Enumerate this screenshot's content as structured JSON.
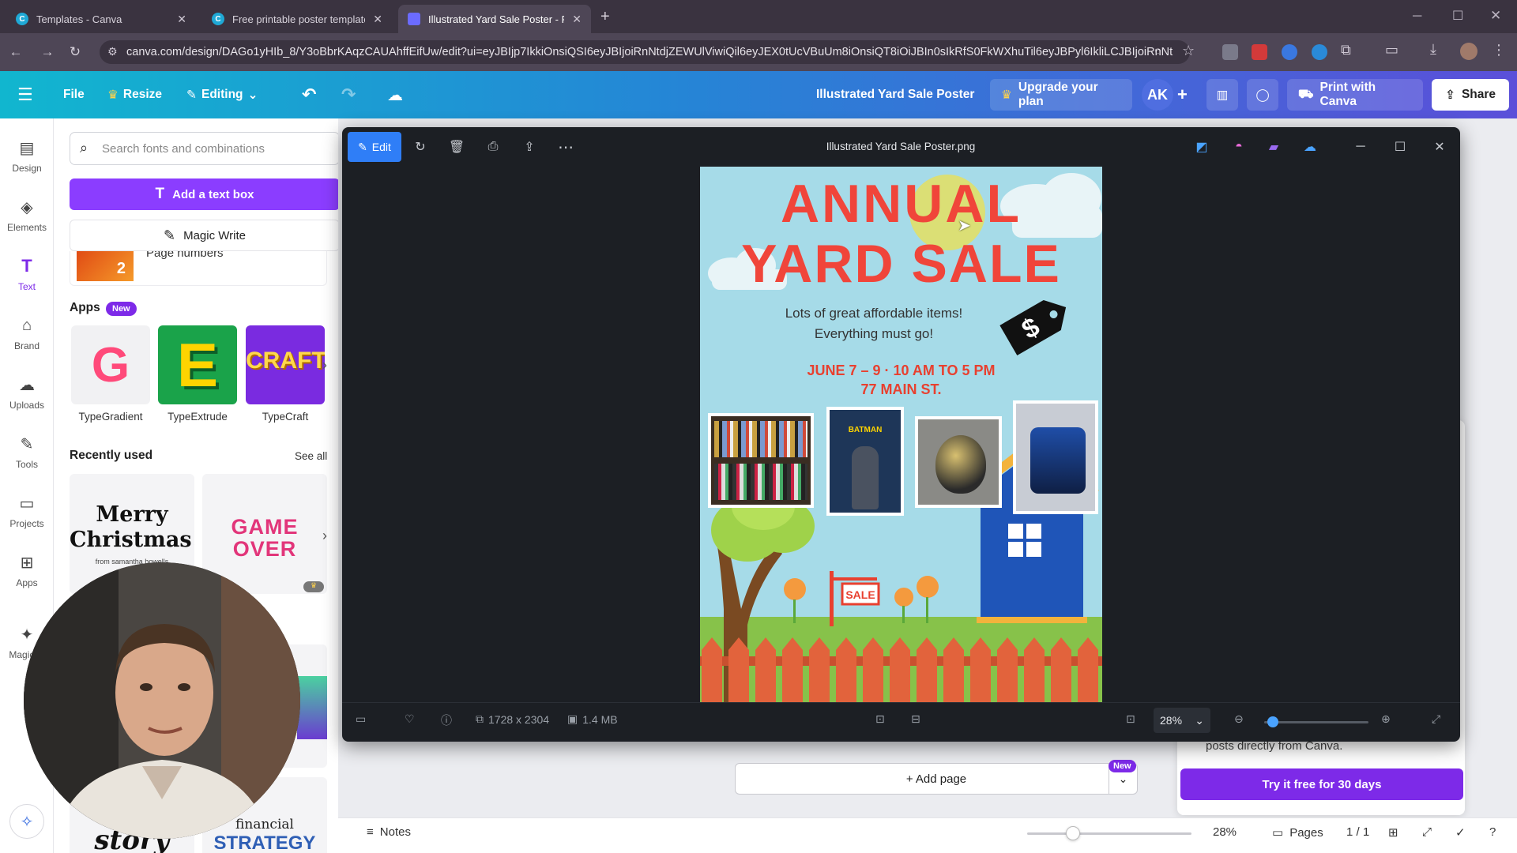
{
  "browser": {
    "tabs": [
      {
        "title": "Templates - Canva",
        "active": false
      },
      {
        "title": "Free printable poster template",
        "active": false
      },
      {
        "title": "Illustrated Yard Sale Poster - Po",
        "active": true
      }
    ],
    "new_tab": "+",
    "url": "canva.com/design/DAGo1yHIb_8/Y3oBbrKAqzCAUAhffEifUw/edit?ui=eyJBIjp7IkkiOnsiQSI6eyJBIjoiRnNtdjZEWUlViwiQil6eyJEX0tUcVBuUm8iOnsiQT8iOiJBIn0sIkRfS0FkWXhuTil6eyJBPyl6IkliLCJBIjoiRnNt"
  },
  "toolbar": {
    "file": "File",
    "resize": "Resize",
    "editing": "Editing",
    "design_title": "Illustrated Yard Sale Poster",
    "upgrade": "Upgrade your plan",
    "avatar": "AK",
    "plus": "+",
    "print": "Print with Canva",
    "share": "Share"
  },
  "rail": {
    "items": [
      {
        "label": "Design",
        "icon": "design-icon"
      },
      {
        "label": "Elements",
        "icon": "elements-icon"
      },
      {
        "label": "Text",
        "icon": "text-icon"
      },
      {
        "label": "Brand",
        "icon": "brand-icon"
      },
      {
        "label": "Uploads",
        "icon": "uploads-icon"
      },
      {
        "label": "Tools",
        "icon": "tools-icon"
      },
      {
        "label": "Projects",
        "icon": "projects-icon"
      },
      {
        "label": "Apps",
        "icon": "apps-icon"
      },
      {
        "label": "Magic M",
        "icon": "magic-media-icon"
      }
    ]
  },
  "panel": {
    "search_placeholder": "Search fonts and combinations",
    "add_text_box": "Add a text box",
    "magic_write": "Magic Write",
    "page_numbers": "Page numbers",
    "page_number_tile": "2",
    "apps_heading": "Apps",
    "apps_badge": "New",
    "apps": [
      {
        "label": "TypeGradient",
        "tile": "G"
      },
      {
        "label": "TypeExtrude",
        "tile": "E"
      },
      {
        "label": "TypeCraft",
        "tile": "CRAFT"
      }
    ],
    "recently_used": "Recently used",
    "see_all": "See all",
    "recent": [
      {
        "line1": "Merry",
        "line2": "Christmas!",
        "sub": "from samantha howells"
      },
      {
        "line1": "GAME",
        "line2": "OVER"
      }
    ],
    "lower_tiles": {
      "financial": "financial",
      "strategy": "STRATEGY",
      "story": "story"
    }
  },
  "viewer": {
    "edit": "Edit",
    "filename": "Illustrated Yard Sale Poster.png",
    "dimensions": "1728 x 2304",
    "filesize": "1.4 MB",
    "zoom": "28%"
  },
  "poster": {
    "line1": "ANNUAL",
    "line2": "YARD SALE",
    "tagline1": "Lots of great affordable items!",
    "tagline2": "Everything must go!",
    "date": "JUNE 7 – 9 · 10 AM TO 5 PM",
    "address": "77 MAIN ST.",
    "sign": "SALE",
    "tag_symbol": "$",
    "figure_label": "BATMAN",
    "colors": {
      "sky": "#a6dbe8",
      "title": "#f0453a",
      "date": "#e8402f",
      "grass": "#87c24a",
      "fence": "#e2633c",
      "house": "#1f55b8"
    }
  },
  "footer": {
    "add_page": "+ Add page",
    "add_page_badge": "New",
    "promo_text": "posts directly from Canva.",
    "try_free": "Try it free for 30 days",
    "notes": "Notes",
    "zoom": "28%",
    "pages": "Pages",
    "page_count": "1 / 1"
  }
}
